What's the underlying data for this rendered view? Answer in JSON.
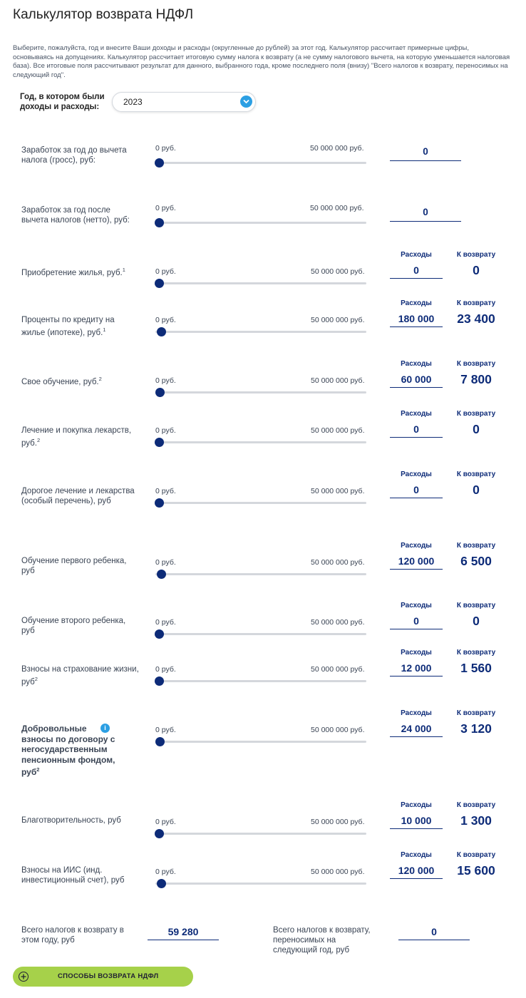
{
  "page": {
    "title": "Калькулятор возврата НДФЛ",
    "intro": "Выберите, пожалуйста, год и внесите Ваши доходы и расходы (округленные до рублей) за этот год. Калькулятор рассчитает примерные цифры, основываясь на допущениях. Калькулятор рассчитает итоговую сумму налога к возврату (а не сумму налогового вычета, на которую уменьшается налоговая база). Все итоговые поля рассчитывают результат для данного, выбранного года, кроме последнего поля (внизу) \"Всего налогов к возврату, переносимых на следующий год\"."
  },
  "year": {
    "label": "Год, в котором были доходы и расходы:",
    "value": "2023"
  },
  "range": {
    "min": "0 руб.",
    "max": "50 000 000 руб."
  },
  "columns": {
    "expenses": "Расходы",
    "refund": "К возврату"
  },
  "income": {
    "gross": {
      "label": "Заработок за год до вычета налога (гросс), руб:",
      "value": "0",
      "slider_fraction": 0
    },
    "net": {
      "label": "Заработок за год после вычета налогов (нетто), руб:",
      "value": "0",
      "slider_fraction": 0
    }
  },
  "rows": [
    {
      "label": "Приобретение жилья, руб.",
      "sup": "1",
      "expenses": "0",
      "refund": "0",
      "slider_fraction": 0
    },
    {
      "label": "Проценты по кредиту на жилье (ипотеке), руб.",
      "sup": "1",
      "expenses": "180 000",
      "refund": "23 400",
      "slider_fraction": 0.0036
    },
    {
      "label": "Свое обучение, руб.",
      "sup": "2",
      "expenses": "60 000",
      "refund": "7 800",
      "slider_fraction": 0.0012
    },
    {
      "label": "Лечение и покупка лекарств, руб.",
      "sup": "2",
      "expenses": "0",
      "refund": "0",
      "slider_fraction": 0
    },
    {
      "label": "Дорогое лечение и лекарства (особый перечень), руб",
      "sup": "",
      "expenses": "0",
      "refund": "0",
      "slider_fraction": 0
    },
    {
      "label": "Обучение первого ребенка, руб",
      "sup": "",
      "expenses": "120 000",
      "refund": "6 500",
      "slider_fraction": 0.0024
    },
    {
      "label": "Обучение второго ребенка, руб",
      "sup": "",
      "expenses": "0",
      "refund": "0",
      "slider_fraction": 0
    },
    {
      "label": "Взносы на страхование жизни, руб",
      "sup": "2",
      "expenses": "12 000",
      "refund": "1 560",
      "slider_fraction": 0.0002
    },
    {
      "label": "Добровольные взносы по договору с негосударственным пенсионным фондом, руб",
      "sup": "2",
      "expenses": "24 000",
      "refund": "3 120",
      "slider_fraction": 0.0005,
      "bold": true,
      "info_icon": "i"
    },
    {
      "label": "Благотворительность, руб",
      "sup": "",
      "expenses": "10 000",
      "refund": "1 300",
      "slider_fraction": 0.0002
    },
    {
      "label": "Взносы на ИИС (инд. инвестиционный счет), руб",
      "sup": "",
      "expenses": "120 000",
      "refund": "15 600",
      "slider_fraction": 0.0024
    }
  ],
  "totals": {
    "this_year_label": "Всего налогов к возврату в этом году, руб",
    "this_year_value": "59 280",
    "carry_over_label": "Всего налогов к возврату, переносимых на следующий год, руб",
    "carry_over_value": "0"
  },
  "cta": {
    "label": "СПОСОБЫ ВОЗВРАТА НДФЛ",
    "icon": "plus-circle-icon"
  },
  "colors": {
    "accent": "#0d2b78",
    "info": "#2c9fe3",
    "cta": "#a6d14a",
    "track": "#d4d7dc"
  }
}
